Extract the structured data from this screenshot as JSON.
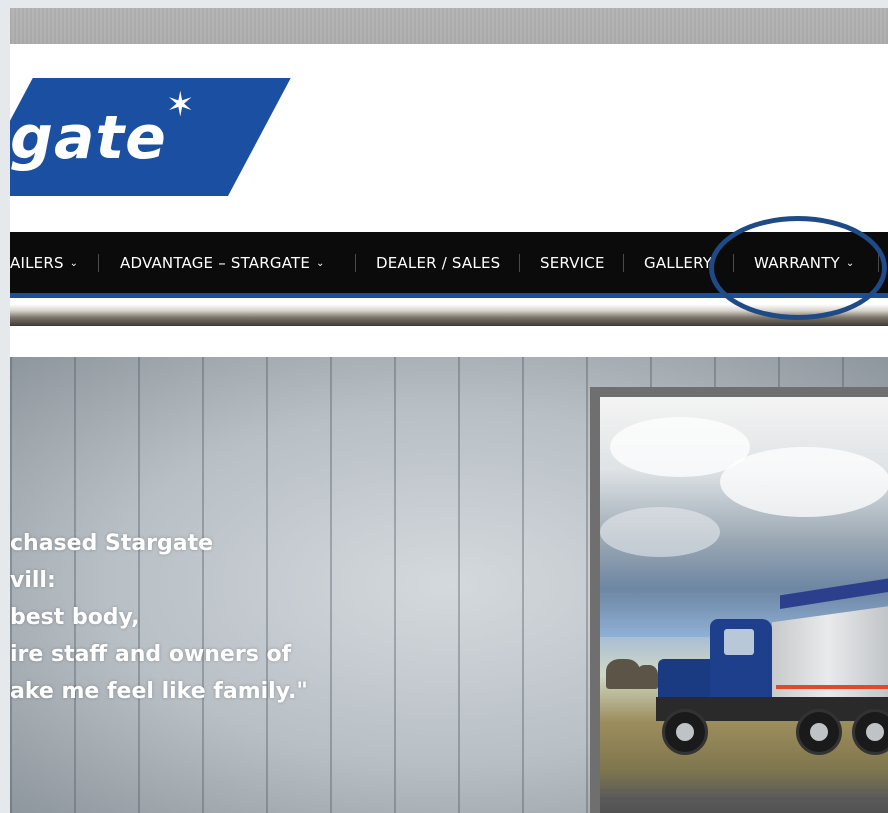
{
  "logo": {
    "text": "gate",
    "star": "✶"
  },
  "nav": {
    "items": [
      {
        "label": "AILERS",
        "chevron": "⌄"
      },
      {
        "label": "ADVANTAGE – STARGATE",
        "chevron": "⌄"
      },
      {
        "label": "DEALER / SALES"
      },
      {
        "label": "SERVICE"
      },
      {
        "label": "GALLERY"
      },
      {
        "label": "WARRANTY",
        "chevron": "⌄"
      }
    ]
  },
  "hero": {
    "quote_lines": [
      "chased Stargate",
      "vill:",
      "best body,",
      "ire staff and owners of",
      "ake me feel like family.\""
    ]
  },
  "colors": {
    "brand_blue": "#1a4fa2",
    "nav_bg": "#0b0b0b",
    "oval": "#1e4a86"
  }
}
